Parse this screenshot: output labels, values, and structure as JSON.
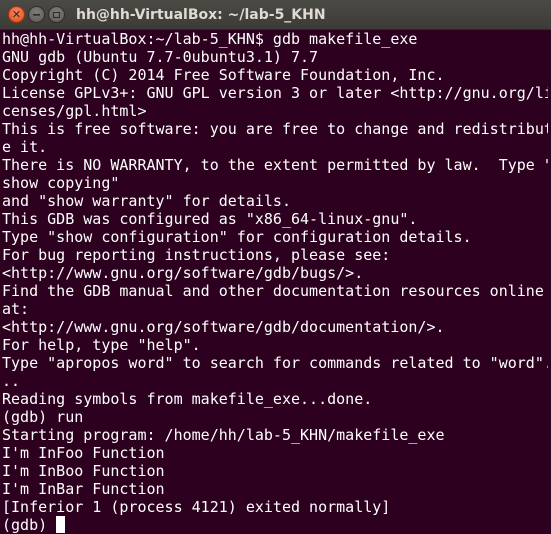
{
  "window": {
    "title": "hh@hh-VirtualBox: ~/lab-5_KHN",
    "close_glyph": "✕"
  },
  "terminal": {
    "lines": [
      "hh@hh-VirtualBox:~/lab-5_KHN$ gdb makefile_exe",
      "GNU gdb (Ubuntu 7.7-0ubuntu3.1) 7.7",
      "Copyright (C) 2014 Free Software Foundation, Inc.",
      "License GPLv3+: GNU GPL version 3 or later <http://gnu.org/li",
      "censes/gpl.html>",
      "This is free software: you are free to change and redistribut",
      "e it.",
      "There is NO WARRANTY, to the extent permitted by law.  Type \"",
      "show copying\"",
      "and \"show warranty\" for details.",
      "This GDB was configured as \"x86_64-linux-gnu\".",
      "Type \"show configuration\" for configuration details.",
      "For bug reporting instructions, please see:",
      "<http://www.gnu.org/software/gdb/bugs/>.",
      "Find the GDB manual and other documentation resources online",
      "at:",
      "<http://www.gnu.org/software/gdb/documentation/>.",
      "For help, type \"help\".",
      "Type \"apropos word\" to search for commands related to \"word\".",
      "..",
      "Reading symbols from makefile_exe...done.",
      "(gdb) run",
      "Starting program: /home/hh/lab-5_KHN/makefile_exe",
      "I'm InFoo Function",
      "I'm InBoo Function",
      "I'm InBar Function",
      "[Inferior 1 (process 4121) exited normally]"
    ],
    "prompt": "(gdb) "
  },
  "colors": {
    "terminal_bg": "#2c001e",
    "terminal_fg": "#ffffff",
    "close_button": "#df4a16",
    "titlebar": "#3c3b37"
  }
}
